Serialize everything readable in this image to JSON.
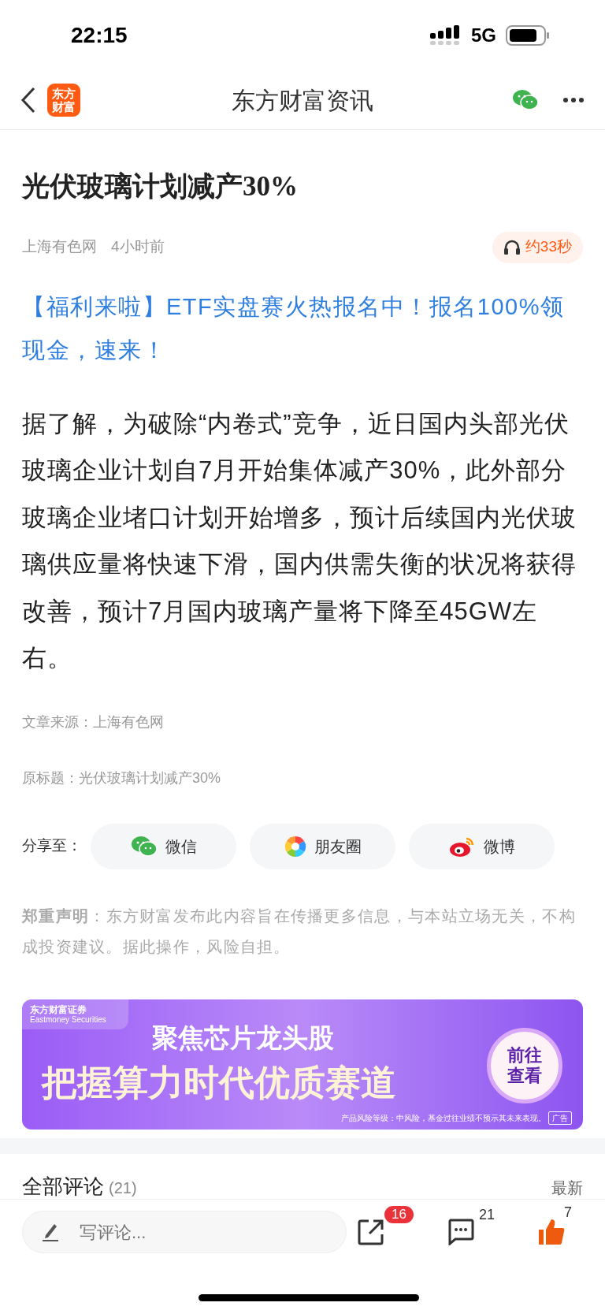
{
  "status_bar": {
    "time": "22:15",
    "network": "5G"
  },
  "nav": {
    "logo": "东方财富",
    "title": "东方财富资讯"
  },
  "article": {
    "title": "光伏玻璃计划减产30%",
    "source": "上海有色网",
    "time": "4小时前",
    "audio": "约33秒",
    "promo": "【福利来啦】ETF实盘赛火热报名中！报名100%领现金，速来！",
    "body": "据了解，为破除“内卷式”竞争，近日国内头部光伏玻璃企业计划自7月开始集体减产30%，此外部分玻璃企业堵口计划开始增多，预计后续国内光伏玻璃供应量将快速下滑，国内供需失衡的状况将获得改善，预计7月国内玻璃产量将下降至45GW左右。",
    "origin": "文章来源：上海有色网",
    "original_title": "原标题：光伏玻璃计划减产30%"
  },
  "share": {
    "label": "分享至：",
    "targets": [
      {
        "kind": "wechat",
        "label": "微信"
      },
      {
        "kind": "moments",
        "label": "朋友圈"
      },
      {
        "kind": "weibo",
        "label": "微博"
      }
    ]
  },
  "disclaimer": "**郑重声明**：东方财富发布此内容旨在传播更多信息，与本站立场无关，不构成投资建议。据此操作，风险自担。",
  "banner": {
    "brand": "东方财富证券",
    "brand_en": "Eastmoney Securities",
    "headline": "聚焦芯片龙头股",
    "subheadline": "把握算力时代优质赛道",
    "cta": "前往查看",
    "risk": "产品风险等级：中风险，基金过往业绩不预示其未来表现。",
    "ad": "广告"
  },
  "comments": {
    "title": "全部评论",
    "count": "(21)",
    "sort": "最新"
  },
  "bottom_bar": {
    "placeholder": "写评论...",
    "share_count": "16",
    "comment_count": "21",
    "like_count": "7",
    "liked": true
  }
}
